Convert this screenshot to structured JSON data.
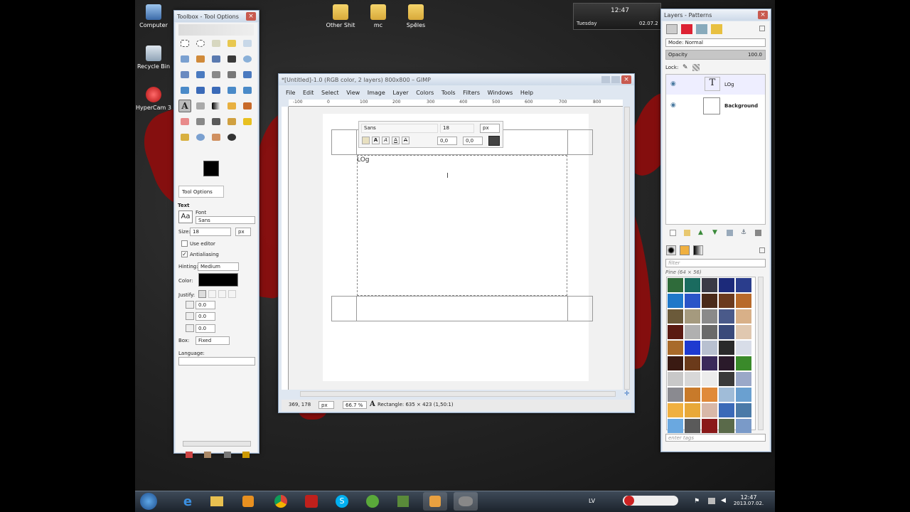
{
  "desktop": {
    "icons": [
      {
        "label": "Computer"
      },
      {
        "label": "Recycle Bin"
      },
      {
        "label": "HyperCam 3"
      },
      {
        "label": "Other Shit"
      },
      {
        "label": "mc"
      },
      {
        "label": "Spēles"
      }
    ],
    "clock_gadget": {
      "time": "12:47",
      "day": "Tuesday",
      "date": "02.07.2"
    }
  },
  "toolbox": {
    "title": "Toolbox - Tool Options",
    "fg_color": "#000000",
    "bg_color": "#ffffff",
    "tool_options": {
      "tab_label": "Tool Options",
      "section_title": "Text",
      "font_label": "Font",
      "font_value": "Sans",
      "font_preview": "Aa",
      "size_label": "Size:",
      "size_value": "18",
      "size_unit": "px",
      "use_editor_label": "Use editor",
      "use_editor_checked": false,
      "antialiasing_label": "Antialiasing",
      "antialiasing_checked": true,
      "hinting_label": "Hinting:",
      "hinting_value": "Medium",
      "color_label": "Color:",
      "text_color": "#000000",
      "justify_label": "Justify:",
      "indent_value": "0.0",
      "line_spacing_value": "0.0",
      "letter_spacing_value": "0.0",
      "box_label": "Box:",
      "box_value": "Fixed",
      "language_label": "Language:"
    }
  },
  "gimp": {
    "title": "*[Untitled]-1.0 (RGB color, 2 layers) 800x800 – GIMP",
    "menu": [
      "File",
      "Edit",
      "Select",
      "View",
      "Image",
      "Layer",
      "Colors",
      "Tools",
      "Filters",
      "Windows",
      "Help"
    ],
    "ruler_labels": [
      "-100",
      "0",
      "100",
      "200",
      "300",
      "400",
      "500",
      "600",
      "700",
      "800"
    ],
    "onscreen_editor": {
      "font": "Sans",
      "size": "18",
      "unit": "px",
      "baseline": "0,0",
      "kerning": "0,0"
    },
    "canvas_text": "LOg",
    "status": {
      "coords": "369, 178",
      "unit": "px",
      "zoom": "66.7 %",
      "message": "Rectangle: 635 × 423  (1,50:1)"
    }
  },
  "layers_dock": {
    "title": "Layers - Patterns",
    "mode_label": "Mode: Normal",
    "opacity_label": "Opacity",
    "opacity_value": "100.0",
    "lock_label": "Lock:",
    "layers": [
      {
        "name": "LOg",
        "type": "text"
      },
      {
        "name": "Background",
        "type": "image"
      }
    ],
    "patterns": {
      "filter_placeholder": "filter",
      "selected": "Pine (64 × 56)",
      "tags_placeholder": "enter tags",
      "swatches": [
        "#2f6b3a",
        "#1a6b5f",
        "#3a3a46",
        "#1c2a7a",
        "#2a3d8c",
        "#1f78c9",
        "#2a55c8",
        "#4a2a1a",
        "#6b3a1e",
        "#b86a2a",
        "#6b5a3a",
        "#a59a7e",
        "#8a8a8a",
        "#4a5a8a",
        "#d8b088",
        "#5a1a12",
        "#b0b0b0",
        "#6a6a6a",
        "#3a4a7a",
        "#e0c8b0",
        "#a86a2a",
        "#1e3ad0",
        "#b8c0d0",
        "#2a2a2a",
        "#d8dde8",
        "#3a1a12",
        "#6b3a1a",
        "#3a2a5a",
        "#2a1a2a",
        "#3a8a2a",
        "#c8c8c8",
        "#d8d8d8",
        "#ececec",
        "#3a3a3a",
        "#9aa8c8",
        "#8a8a90",
        "#c87a2a",
        "#e08a3a",
        "#a0bcd8",
        "#6aa0d0",
        "#f0b040",
        "#e8a838",
        "#d8b8a8",
        "#3a6ab8",
        "#4a7aa8",
        "#6aa8e0",
        "#5a5a5a",
        "#8a1a1a",
        "#5a6a4a",
        "#7a9ac8"
      ]
    }
  },
  "taskbar": {
    "lang": "LV",
    "time": "12:47",
    "date": "2013.07.02."
  }
}
